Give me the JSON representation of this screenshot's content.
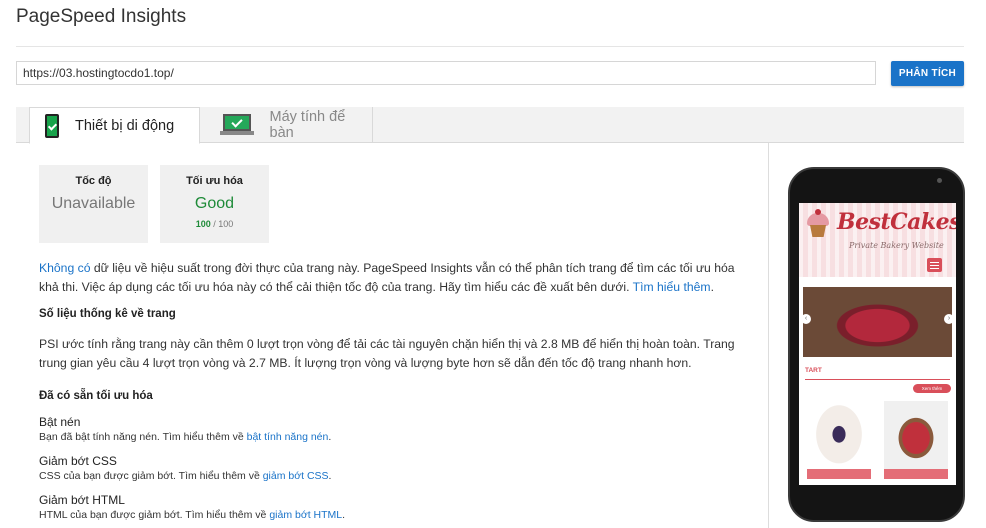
{
  "app": {
    "title": "PageSpeed Insights"
  },
  "search": {
    "url_value": "https://03.hostingtocdo1.top/",
    "analyze_label": "PHÂN TÍCH"
  },
  "tabs": [
    {
      "label": "Thiết bị di động",
      "icon": "mobile-check-icon",
      "active": true
    },
    {
      "label": "Máy tính để bàn",
      "icon": "desktop-check-icon",
      "active": false
    }
  ],
  "scores": {
    "speed": {
      "title": "Tốc độ",
      "value": "Unavailable"
    },
    "optimization": {
      "title": "Tối ưu hóa",
      "value": "Good",
      "score": "100",
      "max": "/ 100",
      "color": "#1f8b39"
    }
  },
  "intro": {
    "link_no_data": "Không có",
    "text_1": " dữ liệu về hiệu suất trong đời thực của trang này. PageSpeed Insights vẫn có thể phân tích trang để tìm các tối ưu hóa khả thi. Việc áp dụng các tối ưu hóa này có thể cải thiện tốc độ của trang. Hãy tìm hiểu các đề xuất bên dưới. ",
    "link_learn_more": "Tìm hiểu thêm",
    "text_2": "."
  },
  "stats": {
    "heading": "Số liệu thống kê về trang",
    "text": "PSI ước tính rằng trang này cần thêm 0 lượt trọn vòng để tải các tài nguyên chặn hiển thị và 2.8 MB để hiển thị hoàn toàn. Trang trung gian yêu cầu 4 lượt trọn vòng và 2.7 MB. Ít lượng trọn vòng và lượng byte hơn sẽ dẫn đến tốc độ trang nhanh hơn."
  },
  "optimizations": {
    "heading": "Đã có sẵn tối ưu hóa",
    "items": [
      {
        "name": "Bật nén",
        "desc": "Bạn đã bật tính năng nén. Tìm hiểu thêm về ",
        "link": "bật tính năng nén",
        "end": "."
      },
      {
        "name": "Giảm bớt CSS",
        "desc": "CSS của bạn được giảm bớt. Tìm hiểu thêm về ",
        "link": "giảm bớt CSS",
        "end": "."
      },
      {
        "name": "Giảm bớt HTML",
        "desc": "HTML của bạn được giảm bớt. Tìm hiểu thêm về ",
        "link": "giảm bớt HTML",
        "end": "."
      }
    ]
  },
  "preview": {
    "logo": "BestCakes",
    "tagline": "Private Bakery Website",
    "section": "TART",
    "view_all": "Xem thêm"
  },
  "colors": {
    "accent": "#1a73c8",
    "good": "#1f8b39",
    "brand_pink": "#d94f5a"
  }
}
